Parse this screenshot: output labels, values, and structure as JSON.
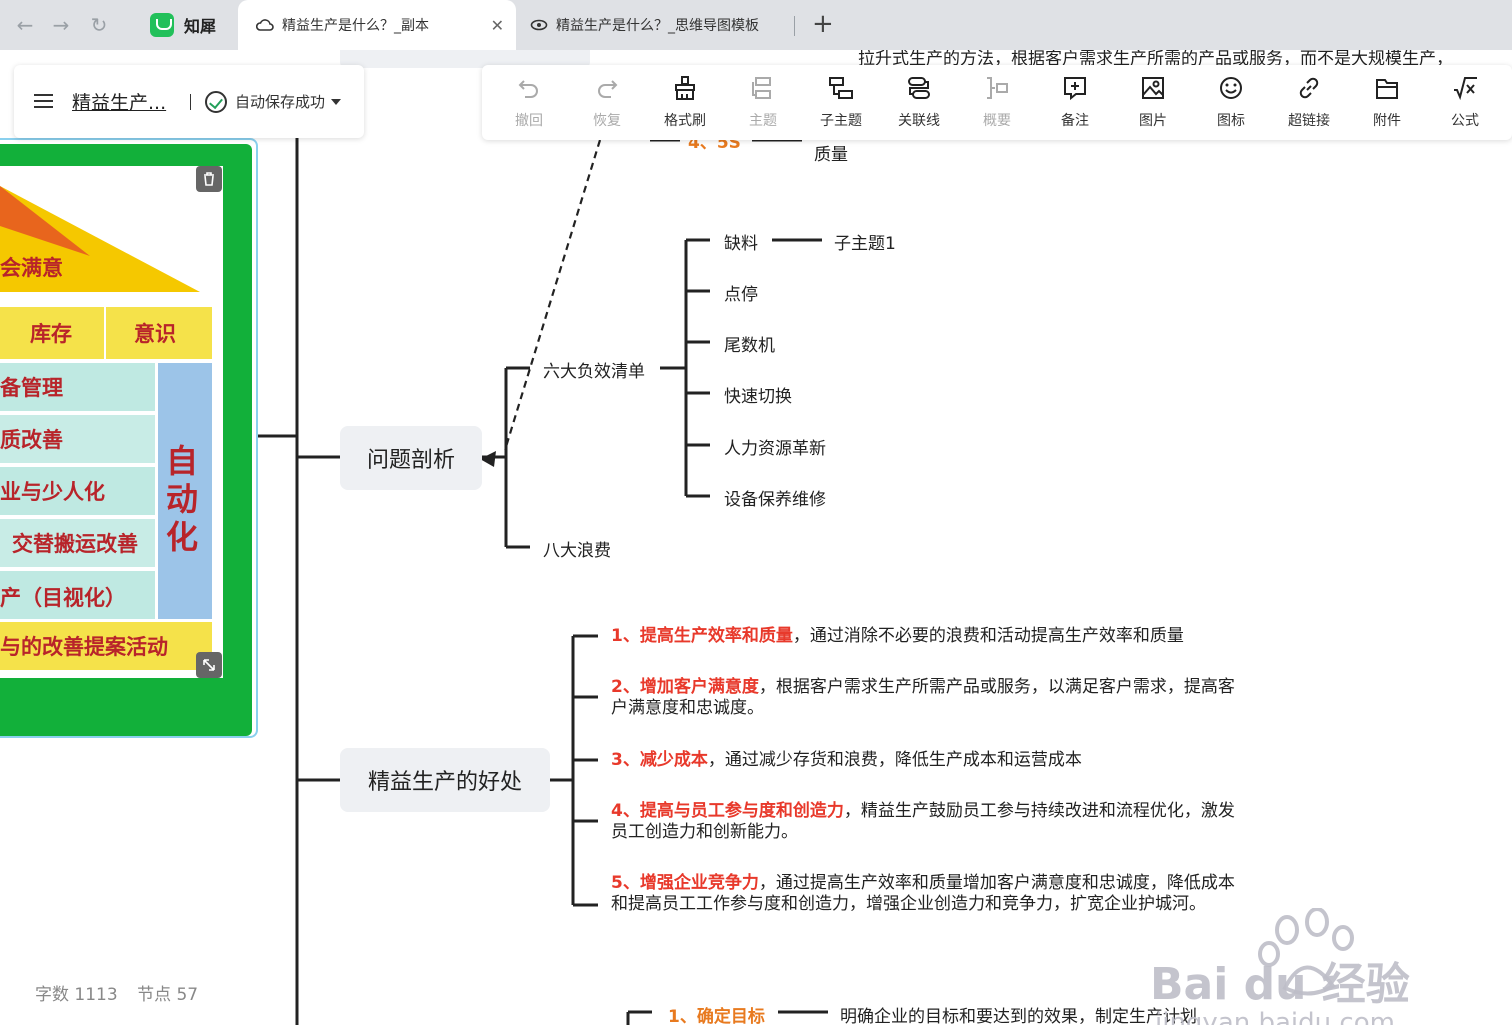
{
  "browser": {
    "tabs": [
      {
        "label": "知犀",
        "type": "app"
      },
      {
        "label": "精益生产是什么？_副本",
        "active": true
      },
      {
        "label": "精益生产是什么？_思维导图模板"
      }
    ]
  },
  "header": {
    "doc_title": "精益生产...",
    "save_status": "自动保存成功"
  },
  "toolbar": {
    "items": [
      {
        "label": "撤回",
        "icon": "undo-icon",
        "enabled": false
      },
      {
        "label": "恢复",
        "icon": "redo-icon",
        "enabled": false
      },
      {
        "label": "格式刷",
        "icon": "format-brush-icon",
        "enabled": true
      },
      {
        "label": "主题",
        "icon": "topic-icon",
        "enabled": false
      },
      {
        "label": "子主题",
        "icon": "subtopic-icon",
        "enabled": true
      },
      {
        "label": "关联线",
        "icon": "relation-line-icon",
        "enabled": true
      },
      {
        "label": "概要",
        "icon": "summary-icon",
        "enabled": false
      },
      {
        "label": "备注",
        "icon": "note-icon",
        "enabled": true
      },
      {
        "label": "图片",
        "icon": "image-icon",
        "enabled": true
      },
      {
        "label": "图标",
        "icon": "emoji-icon",
        "enabled": true
      },
      {
        "label": "超链接",
        "icon": "link-icon",
        "enabled": true
      },
      {
        "label": "附件",
        "icon": "attachment-icon",
        "enabled": true
      },
      {
        "label": "公式",
        "icon": "formula-icon",
        "enabled": true
      }
    ]
  },
  "mindmap": {
    "top_partial_text": "拉升式生产的方法，根据客户需求生产所需的产品或服务，而不是大规模生产，",
    "top_item": {
      "num": "4、5S",
      "desc": "质量"
    },
    "problem_node": "问题剖析",
    "six_list": {
      "label": "六大负效清单",
      "children": [
        "缺料",
        "点停",
        "尾数机",
        "快速切换",
        "人力资源革新",
        "设备保养维修"
      ],
      "sub": "子主题1"
    },
    "eight_waste": "八大浪费",
    "benefits_node": "精益生产的好处",
    "benefits": [
      {
        "head": "1、提高生产效率和质量",
        "tail": "，通过消除不必要的浪费和活动提高生产效率和质量"
      },
      {
        "head": "2、增加客户满意度",
        "tail": "，根据客户需求生产所需产品或服务，以满足客户需求，提高客户满意度和忠诚度。"
      },
      {
        "head": "3、减少成本",
        "tail": "，通过减少存货和浪费，降低生产成本和运营成本"
      },
      {
        "head": "4、提高与员工参与度和创造力",
        "tail": "，精益生产鼓励员工参与持续改进和流程优化，激发员工创造力和创新能力。"
      },
      {
        "head": "5、增强企业竞争力",
        "tail": "，通过提高生产效率和质量增加客户满意度和忠诚度，降低成本和提高员工工作参与度和创造力，增强企业创造力和竞争力，扩宽企业护城河。"
      }
    ],
    "bottom_item": {
      "num": "1、确定目标",
      "desc": "明确企业的目标和要达到的效果，制定生产计划"
    }
  },
  "image_node": {
    "texts": [
      "会满意",
      "库存",
      "意识",
      "备管理",
      "质改善",
      "业与少人化",
      "交替搬运改善",
      "产（目视化）",
      "与的改善提案活动"
    ],
    "vertical": "自动化"
  },
  "stats": {
    "word_label": "字数",
    "word_count": "1113",
    "node_label": "节点",
    "node_count": "57"
  },
  "watermark": {
    "text": "Bai du 经验",
    "url": "jingyan.baidu.com"
  },
  "colors": {
    "accent_red": "#e8392b",
    "accent_orange": "#e87a1f",
    "image_bg": "#12b03a"
  }
}
